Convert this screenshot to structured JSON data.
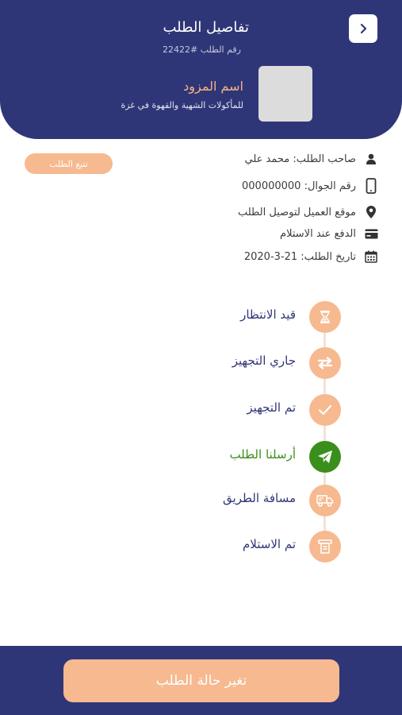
{
  "header": {
    "title": "تفاصيل الطلب",
    "order_number": "رقم الطلب #22422",
    "provider_name": "اسم المزود",
    "provider_description": "للمأكولات الشهية والقهوة في غزة",
    "back_icon": "chevron-right-icon"
  },
  "info": {
    "track_button": "تتبع الطلب",
    "owner": "صاحب الطلب: محمد علي",
    "phone": "رقم الجوال: 000000000",
    "location": "موقع العميل لتوصيل الطلب",
    "payment": "الدفع عند الاستلام",
    "date": "تاريخ الطلب: 21-3-2020"
  },
  "timeline": {
    "steps": [
      {
        "label": "قيد الانتظار",
        "icon": "hourglass-icon",
        "active": false
      },
      {
        "label": "جاري التجهيز",
        "icon": "exchange-icon",
        "active": false
      },
      {
        "label": "تم التجهيز",
        "icon": "check-icon",
        "active": false
      },
      {
        "label": "أرسلنا الطلب",
        "icon": "paper-plane-icon",
        "active": true
      },
      {
        "label": "مسافة الطريق",
        "icon": "delivery-truck-icon",
        "active": false
      },
      {
        "label": "تم الاستلام",
        "icon": "receipt-icon",
        "active": false
      }
    ]
  },
  "footer": {
    "change_status_button": "تغير حالة الطلب"
  },
  "colors": {
    "primary": "#2f3677",
    "accent": "#f7b98f",
    "active": "#3a8f1c"
  }
}
